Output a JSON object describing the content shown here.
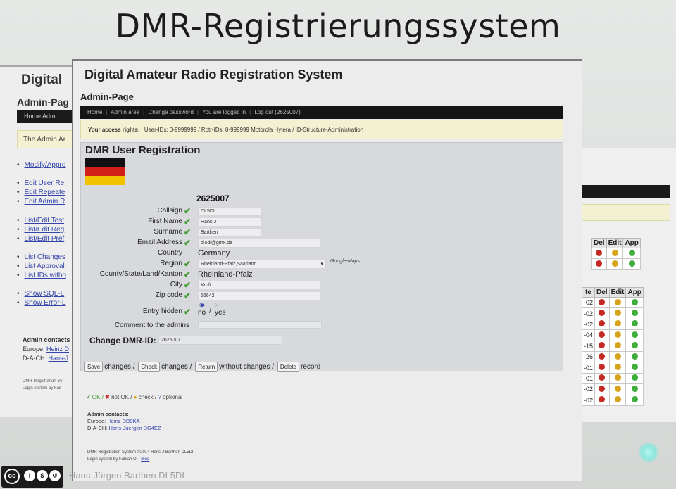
{
  "slide": {
    "title": "DMR-Registrierungssystem",
    "credit": "Hans-Jürgen Barthen DL5DI"
  },
  "back_window": {
    "title": "Digital",
    "admin_page": "Admin-Pag",
    "nav": "Home Admi",
    "info": "The Admin Ar",
    "links_group1": [
      "Modify/Appro"
    ],
    "links_group2": [
      "Edit User Re",
      "Edit Repeate",
      "Edit Admin R"
    ],
    "links_group3": [
      "List/Edit Test",
      "List/Edit Reg",
      "List/Edit Pref"
    ],
    "links_group4": [
      "List Changes",
      "List Approval",
      "List IDs witho"
    ],
    "links_group5": [
      "Show SQL-L",
      "Show Error-L"
    ],
    "contacts_title": "Admin contacts",
    "europe_label": "Europe:",
    "europe_value": "Heinz D",
    "dach_label": "D-A-CH:",
    "dach_value": "Hans-J",
    "foot1": "DMR-Registration Sy",
    "foot2": "Login system by Fab"
  },
  "right_window": {
    "table1": {
      "headers": [
        "Del",
        "Edit",
        "App"
      ],
      "rows": 2
    },
    "table2": {
      "headers": [
        "te",
        "Del",
        "Edit",
        "App"
      ],
      "dates": [
        "-02",
        "-02",
        "-02",
        "-04",
        "-15",
        "-26",
        "-01",
        "-01",
        "-02",
        "-02"
      ]
    }
  },
  "main": {
    "title": "Digital Amateur Radio Registration System",
    "admin_page": "Admin-Page",
    "nav": [
      "Home",
      "Admin area",
      "Change password",
      "You are logged in",
      "Log out (2625007)"
    ],
    "rights_label": "Your access rights:",
    "rights_value": "User-IDs: 0-9999999 / Rptr-IDs: 0-999999 Motorola Hytera / ID-Structure-Administration",
    "heading": "DMR User Registration",
    "flag_colors": [
      "#111111",
      "#d21f1a",
      "#f2c200"
    ],
    "dmr_id": "2625007",
    "form": {
      "callsign_label": "Callsign",
      "callsign_value": "DL5DI",
      "firstname_label": "First Name",
      "firstname_value": "Hans-J",
      "surname_label": "Surname",
      "surname_value": "Barthen",
      "email_label": "Email Address",
      "email_value": "dl5di@gmx.de",
      "country_label": "Country",
      "country_value": "Germany",
      "region_label": "Region",
      "region_value": "Rheinland-Pfalz,Saarland",
      "county_label": "County/State/Land/Kanton",
      "county_value": "Rheinland-Pfalz",
      "google_maps": "Google-Maps",
      "city_label": "City",
      "city_value": "Kruft",
      "zip_label": "Zip code",
      "zip_value": "56642",
      "hidden_label": "Entry hidden",
      "hidden_no": "no",
      "hidden_yes": "yes",
      "comment_label": "Comment to the admins",
      "comment_value": ""
    },
    "change_id_label": "Change DMR-ID:",
    "change_id_value": "2625007",
    "actions": {
      "save": "Save",
      "save_text": "changes /",
      "check": "Check",
      "check_text": "changes /",
      "return": "Return",
      "return_text": "without changes /",
      "delete": "Delete",
      "delete_text": "record"
    },
    "legend": {
      "ok": "✔ OK /",
      "notok_sym": "✖",
      "notok": "not OK /",
      "check_sym": "●",
      "check": "check /",
      "optional_sym": "?",
      "optional": "optional"
    },
    "contacts": {
      "title": "Admin contacts:",
      "europe_label": "Europe:",
      "europe_value": "Heinz DD9KA",
      "dach_label": "D-A-CH:",
      "dach_value": "Hans-Juergen DG4EZ"
    },
    "footer": {
      "line1": "DMR Registration System ©2014 Hans-J Barthen DL5DI",
      "line2_prefix": "Login system by Fabian O. |",
      "line2_link": "Blog"
    }
  }
}
